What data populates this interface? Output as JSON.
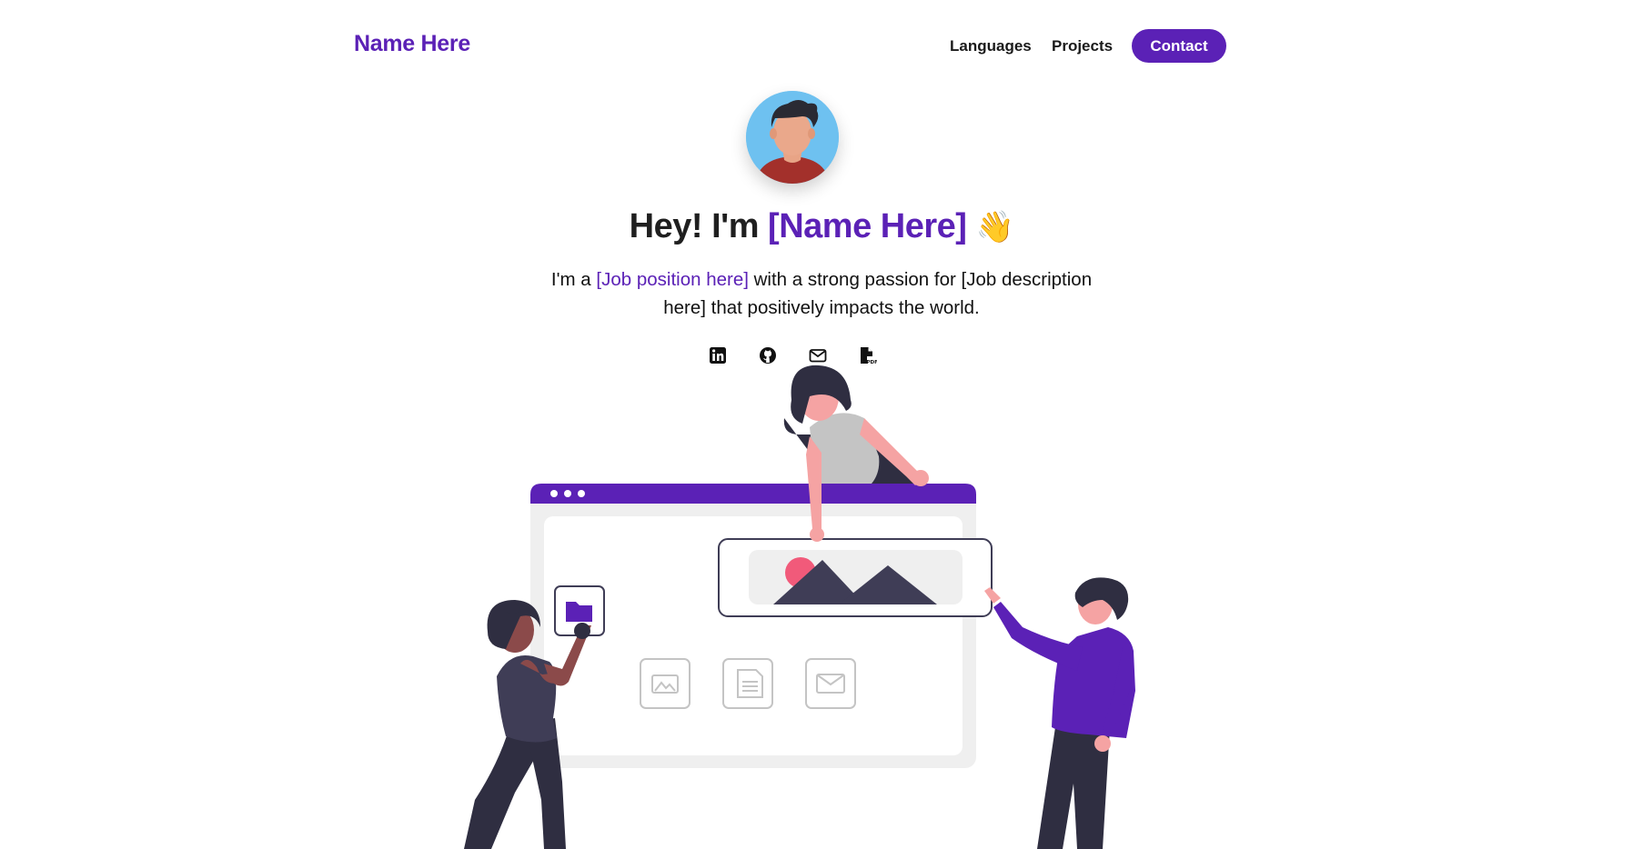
{
  "nav": {
    "brand": "Name Here",
    "links": [
      "Languages",
      "Projects"
    ],
    "contact": "Contact"
  },
  "hero": {
    "greeting": "Hey! I'm ",
    "name": "[Name Here]",
    "wave_emoji": "👋",
    "sub_prefix": "I'm a ",
    "sub_job": "[Job position here]",
    "sub_suffix": " with a strong passion for [Job description here] that positively impacts the world."
  },
  "social_icons": [
    "linkedin-icon",
    "github-icon",
    "mail-icon",
    "pdf-icon"
  ],
  "colors": {
    "accent": "#5b21b6",
    "text": "#1f1f1f",
    "background": "#ffffff"
  }
}
